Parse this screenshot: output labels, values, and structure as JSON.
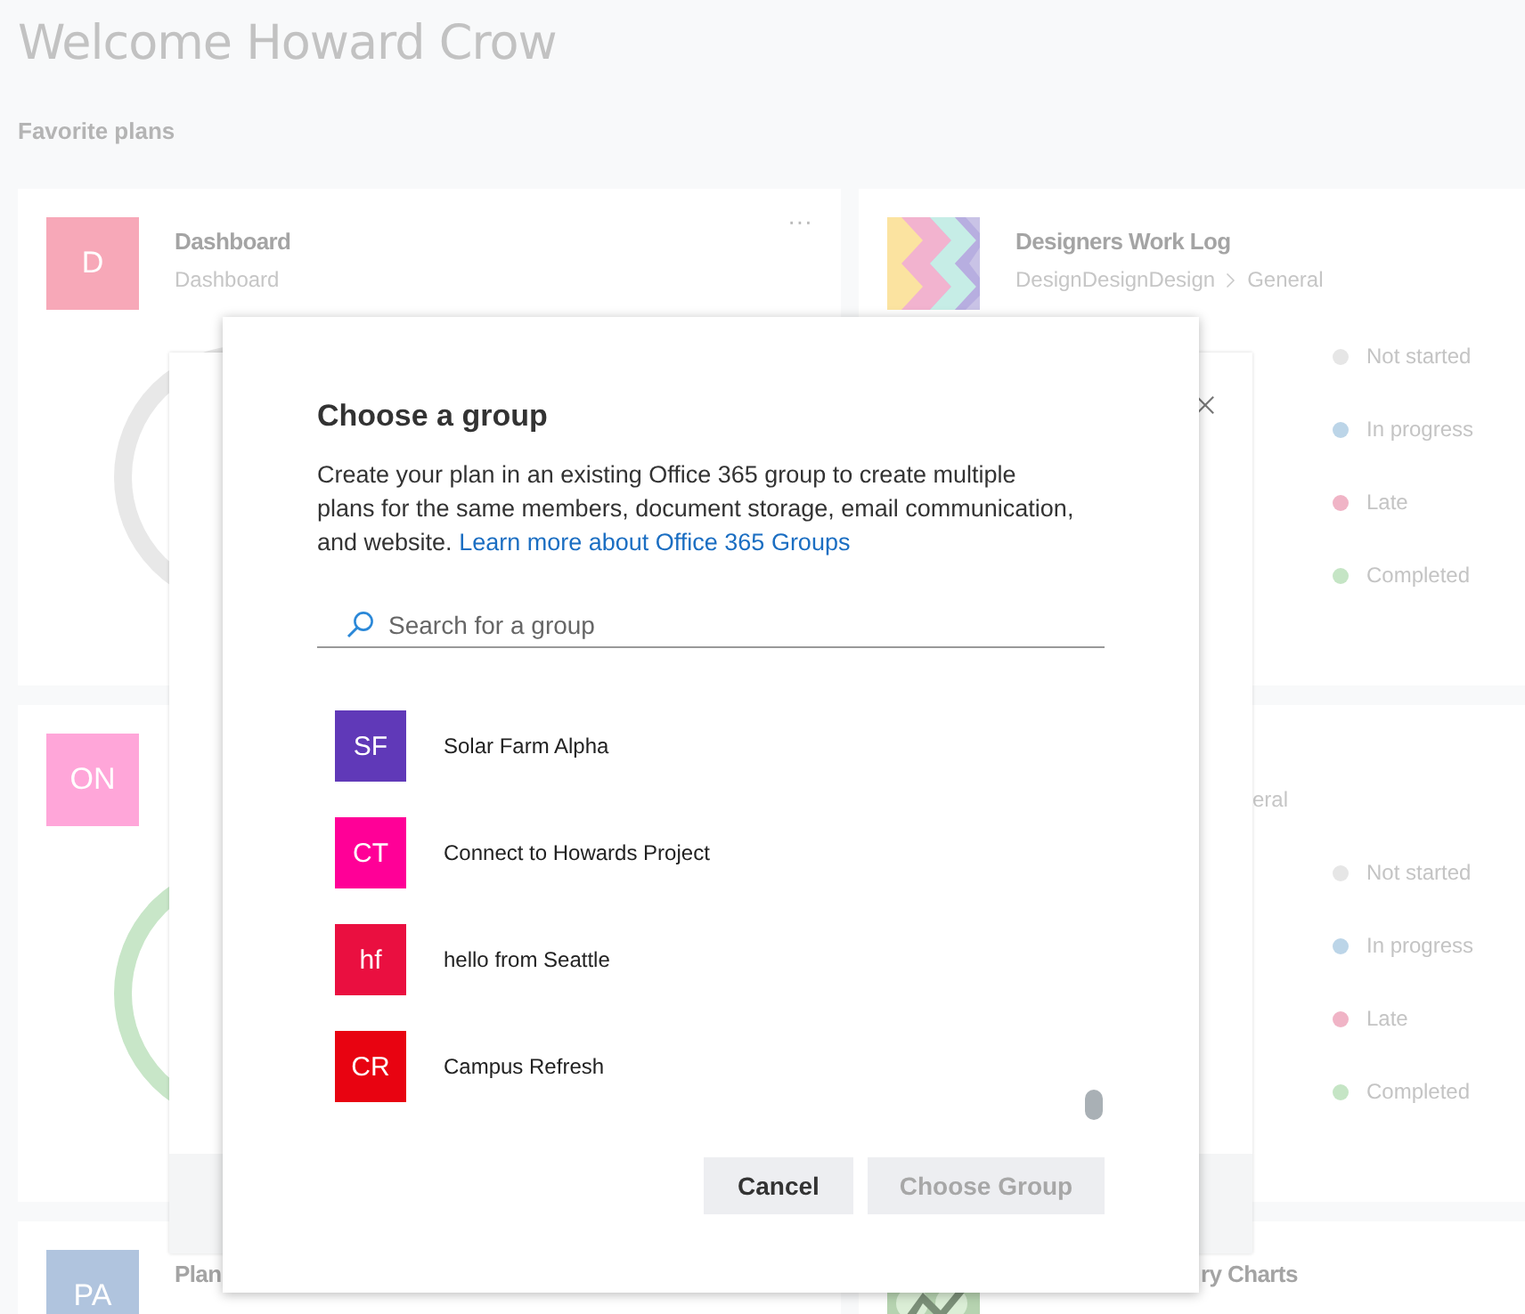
{
  "page": {
    "title": "Welcome Howard Crow",
    "section": "Favorite plans"
  },
  "plans": [
    {
      "avatar": {
        "kind": "letter",
        "text": "D",
        "color": "#f7a8b8"
      },
      "title": "Dashboard",
      "subtitle": "Dashboard",
      "more": "···",
      "ring": {
        "color": "#e8e8e8"
      }
    },
    {
      "title": "Designers Work Log",
      "subtitle": "DesignDesignDesign",
      "group": "General",
      "legend": [
        {
          "label": "Not started",
          "color": "#e6e6e6"
        },
        {
          "label": "In progress",
          "color": "#bcd5e8"
        },
        {
          "label": "Late",
          "color": "#f0b4c6"
        },
        {
          "label": "Completed",
          "color": "#c5e5c5"
        }
      ]
    },
    {
      "avatar": {
        "kind": "letter",
        "text": "ON",
        "color": "#ffa6d9"
      },
      "ring": {
        "color": "#c8e6c8"
      }
    },
    {
      "subtitle": "eral",
      "cut": true,
      "legend": [
        {
          "label": "Not started",
          "color": "#e6e6e6"
        },
        {
          "label": "In progress",
          "color": "#bcd5e8"
        },
        {
          "label": "Late",
          "color": "#f0b4c6"
        },
        {
          "label": "Completed",
          "color": "#c5e5c5"
        }
      ]
    },
    {
      "avatar": {
        "kind": "letter",
        "text": "PA",
        "color": "#b0c4de"
      },
      "title": "Plan"
    },
    {
      "title": "ry Charts",
      "cut": true
    }
  ],
  "dialog": {
    "title": "Choose a group",
    "description": "Create your plan in an existing Office 365 group to create multiple plans for the same members, document storage, email communication, and website.",
    "link": "Learn more about Office 365 Groups",
    "search": {
      "placeholder": "Search for a group"
    },
    "groups": [
      {
        "initials": "SF",
        "name": "Solar Farm Alpha",
        "color": "#6039b8"
      },
      {
        "initials": "CT",
        "name": "Connect to Howards Project",
        "color": "#ff0097"
      },
      {
        "initials": "hf",
        "name": "hello from Seattle",
        "color": "#ea0f40"
      },
      {
        "initials": "CR",
        "name": "Campus Refresh",
        "color": "#e80311"
      }
    ],
    "buttons": [
      {
        "label": "Cancel",
        "disabled": false
      },
      {
        "label": "Choose Group",
        "disabled": true
      }
    ]
  }
}
